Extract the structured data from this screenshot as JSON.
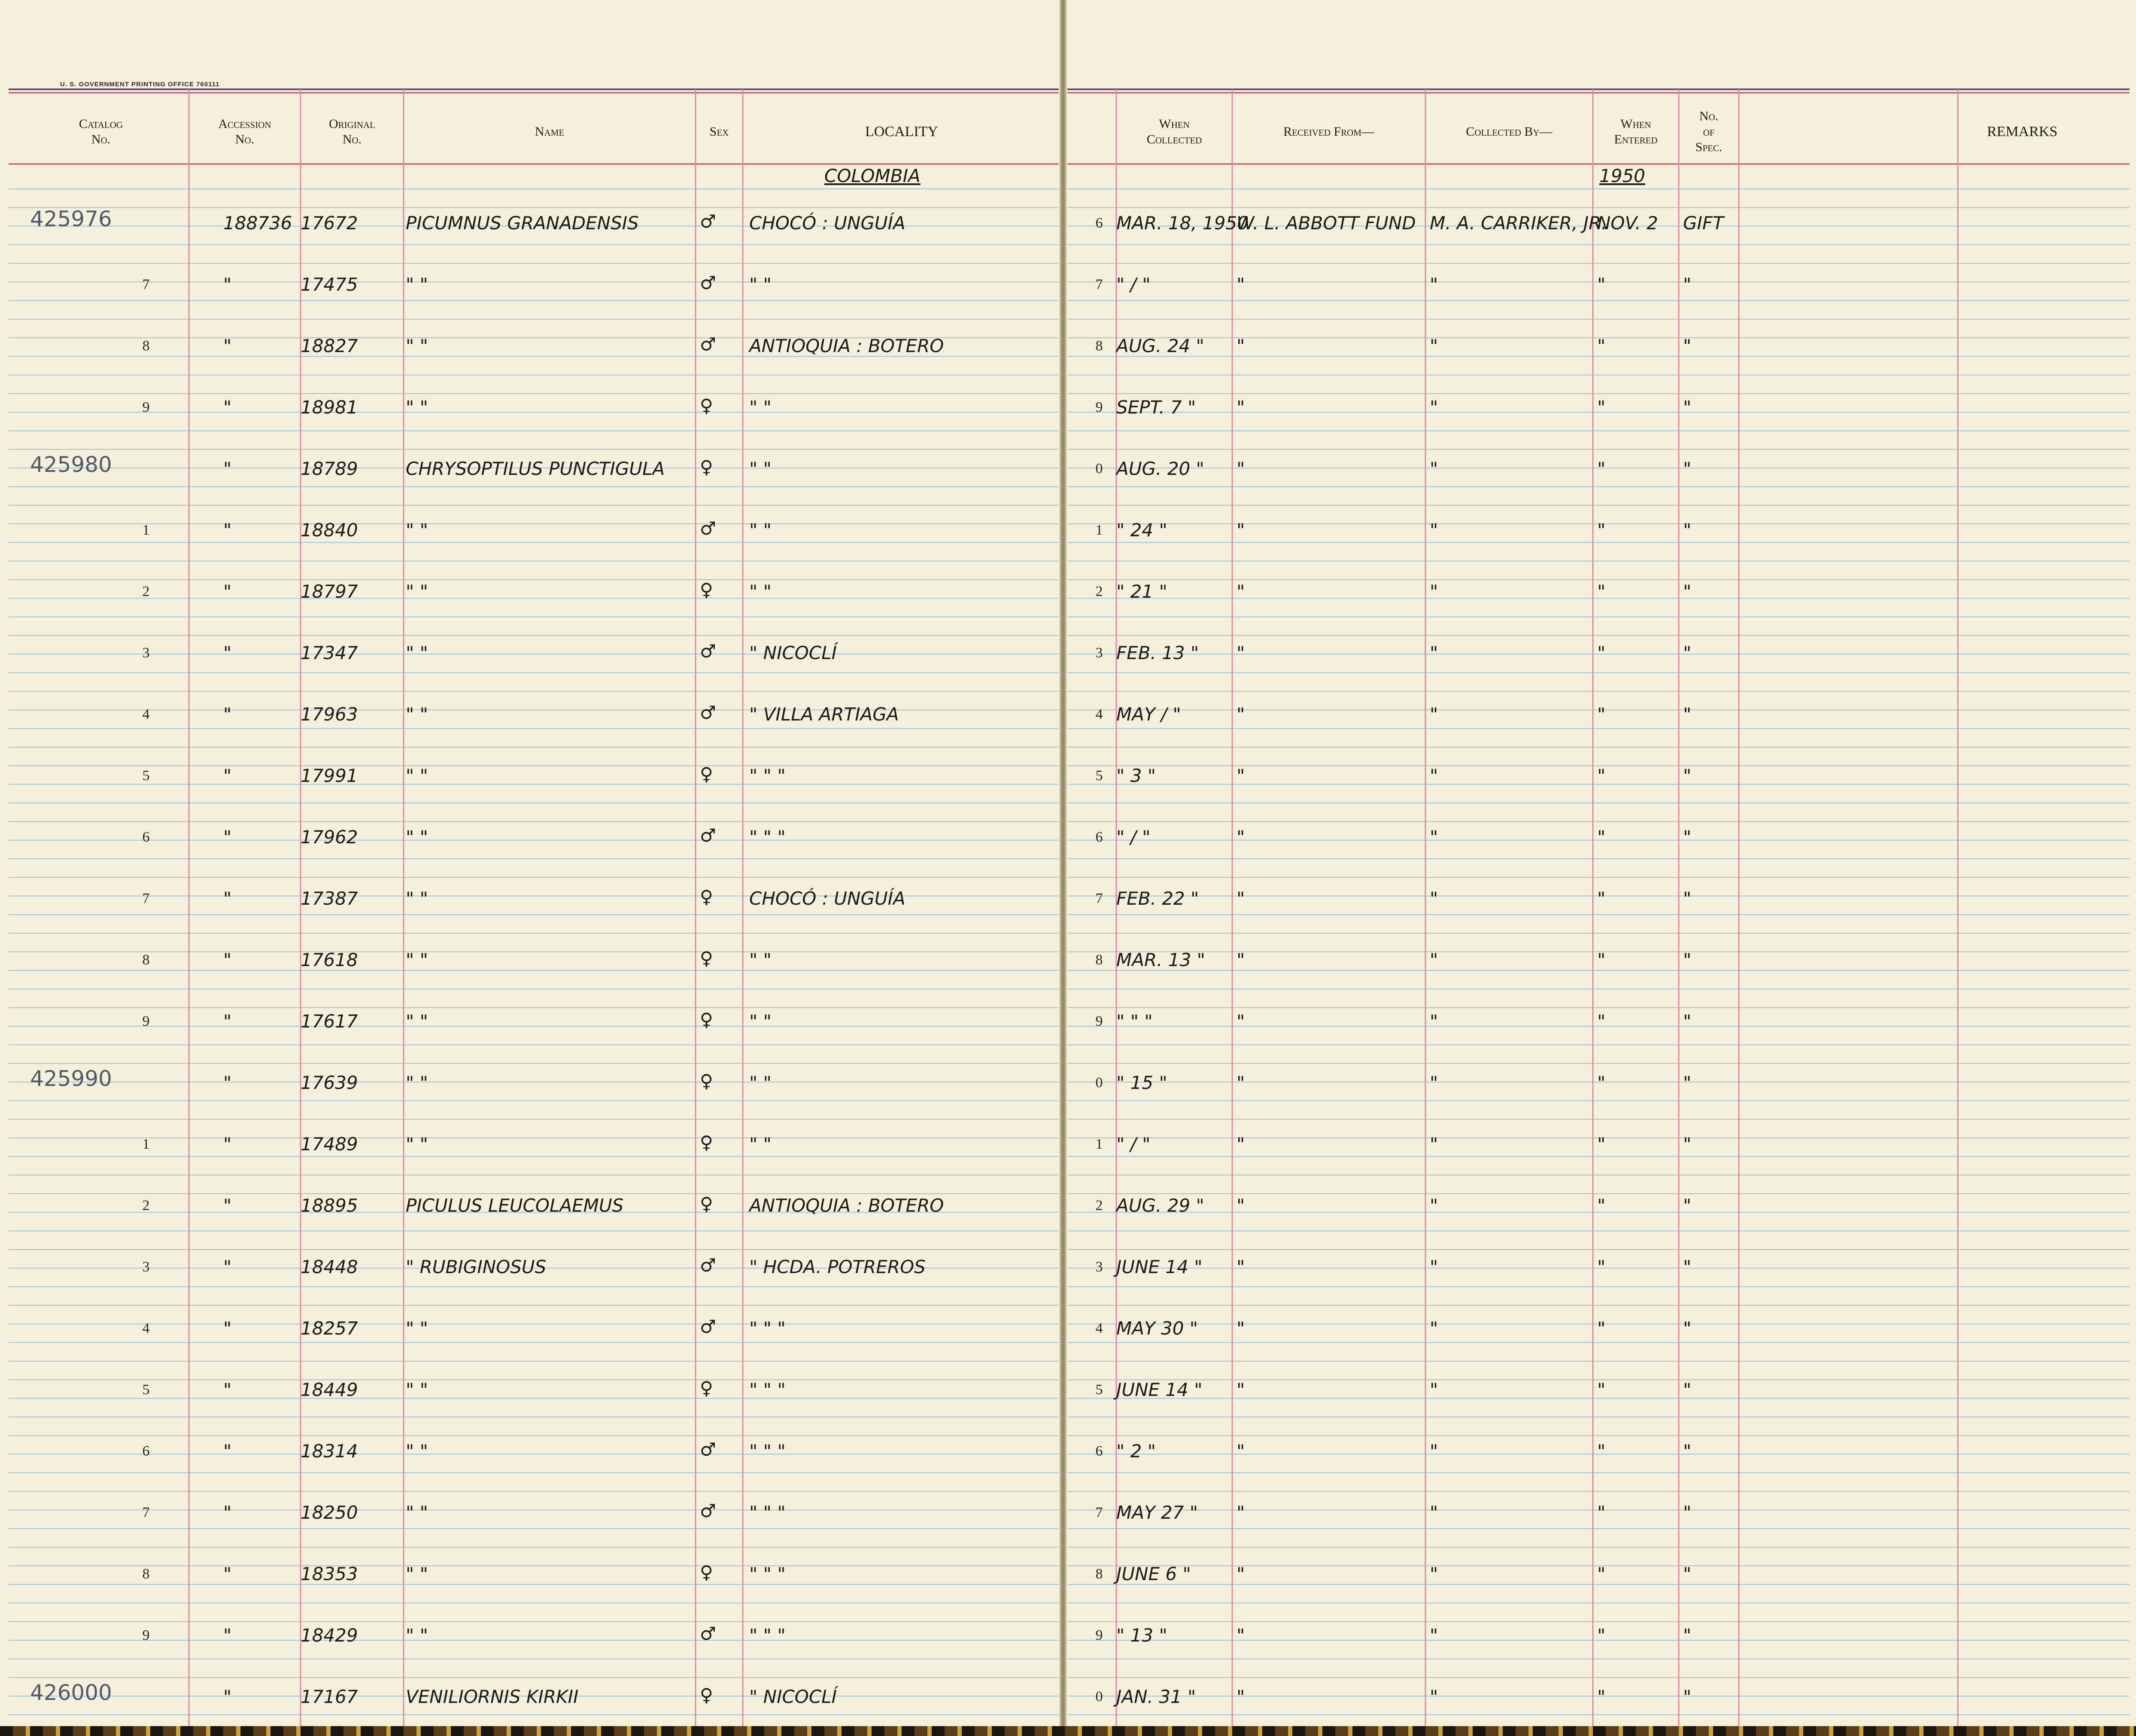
{
  "header": {
    "printer": "U. S. GOVERNMENT PRINTING OFFICE   760111",
    "columns": {
      "catalog": "Catalog\nNo.",
      "accession": "Accession\nNo.",
      "original": "Original\nNo.",
      "name": "Name",
      "sex": "Sex",
      "locality": "LOCALITY",
      "when_collected": "When\nCollected",
      "received_from": "Received From—",
      "collected_by": "Collected By—",
      "when_entered": "When\nEntered",
      "no_of_spec": "No.\nof\nSpec.",
      "remarks": "REMARKS"
    }
  },
  "section": {
    "locality_heading": "COLOMBIA",
    "year": "1950"
  },
  "rows": [
    {
      "catalog": "425976",
      "acc": "188736",
      "orig": "17672",
      "name": "PICUMNUS GRANADENSIS",
      "sex": "♂",
      "loc": "CHOCÓ : UNGUÍA",
      "num": "6",
      "when": "MAR. 18, 1950",
      "recv": "W. L. ABBOTT FUND",
      "coll": "M. A. CARRIKER, JR.",
      "entered": "NOV. 2",
      "spec": "GIFT"
    },
    {
      "catalog": "",
      "rn": "7",
      "acc": "\"",
      "orig": "17475",
      "name": "\"             \"",
      "sex": "♂",
      "loc": "\"       \"",
      "num": "7",
      "when": "\" / \"",
      "recv": "\"",
      "coll": "\"",
      "entered": "\"",
      "spec": "\""
    },
    {
      "catalog": "",
      "rn": "8",
      "acc": "\"",
      "orig": "18827",
      "name": "\"             \"",
      "sex": "♂",
      "loc": "ANTIOQUIA : BOTERO",
      "num": "8",
      "when": "AUG. 24 \"",
      "recv": "\"",
      "coll": "\"",
      "entered": "\"",
      "spec": "\""
    },
    {
      "catalog": "",
      "rn": "9",
      "acc": "\"",
      "orig": "18981",
      "name": "\"             \"",
      "sex": "♀",
      "loc": "\"       \"",
      "num": "9",
      "when": "SEPT. 7 \"",
      "recv": "\"",
      "coll": "\"",
      "entered": "\"",
      "spec": "\""
    },
    {
      "catalog": "425980",
      "acc": "\"",
      "orig": "18789",
      "name": "CHRYSOPTILUS PUNCTIGULA",
      "sex": "♀",
      "loc": "\"       \"",
      "num": "0",
      "when": "AUG. 20 \"",
      "recv": "\"",
      "coll": "\"",
      "entered": "\"",
      "spec": "\""
    },
    {
      "catalog": "",
      "rn": "1",
      "acc": "\"",
      "orig": "18840",
      "name": "\"             \"",
      "sex": "♂",
      "loc": "\"       \"",
      "num": "1",
      "when": "\" 24 \"",
      "recv": "\"",
      "coll": "\"",
      "entered": "\"",
      "spec": "\""
    },
    {
      "catalog": "",
      "rn": "2",
      "acc": "\"",
      "orig": "18797",
      "name": "\"             \"",
      "sex": "♀",
      "loc": "\"       \"",
      "num": "2",
      "when": "\" 21 \"",
      "recv": "\"",
      "coll": "\"",
      "entered": "\"",
      "spec": "\""
    },
    {
      "catalog": "",
      "rn": "3",
      "acc": "\"",
      "orig": "17347",
      "name": "\"             \"",
      "sex": "♂",
      "loc": "\"       NICOCLÍ",
      "num": "3",
      "when": "FEB. 13 \"",
      "recv": "\"",
      "coll": "\"",
      "entered": "\"",
      "spec": "\""
    },
    {
      "catalog": "",
      "rn": "4",
      "acc": "\"",
      "orig": "17963",
      "name": "\"             \"",
      "sex": "♂",
      "loc": "\"       VILLA ARTIAGA",
      "num": "4",
      "when": "MAY / \"",
      "recv": "\"",
      "coll": "\"",
      "entered": "\"",
      "spec": "\""
    },
    {
      "catalog": "",
      "rn": "5",
      "acc": "\"",
      "orig": "17991",
      "name": "\"             \"",
      "sex": "♀",
      "loc": "\"       \"     \"",
      "num": "5",
      "when": "\" 3 \"",
      "recv": "\"",
      "coll": "\"",
      "entered": "\"",
      "spec": "\""
    },
    {
      "catalog": "",
      "rn": "6",
      "acc": "\"",
      "orig": "17962",
      "name": "\"             \"",
      "sex": "♂",
      "loc": "\"       \"     \"",
      "num": "6",
      "when": "\" / \"",
      "recv": "\"",
      "coll": "\"",
      "entered": "\"",
      "spec": "\""
    },
    {
      "catalog": "",
      "rn": "7",
      "acc": "\"",
      "orig": "17387",
      "name": "\"             \"",
      "sex": "♀",
      "loc": "CHOCÓ : UNGUÍA",
      "num": "7",
      "when": "FEB. 22 \"",
      "recv": "\"",
      "coll": "\"",
      "entered": "\"",
      "spec": "\""
    },
    {
      "catalog": "",
      "rn": "8",
      "acc": "\"",
      "orig": "17618",
      "name": "\"             \"",
      "sex": "♀",
      "loc": "\"       \"",
      "num": "8",
      "when": "MAR. 13 \"",
      "recv": "\"",
      "coll": "\"",
      "entered": "\"",
      "spec": "\""
    },
    {
      "catalog": "",
      "rn": "9",
      "acc": "\"",
      "orig": "17617",
      "name": "\"             \"",
      "sex": "♀",
      "loc": "\"       \"",
      "num": "9",
      "when": "\" \" \"",
      "recv": "\"",
      "coll": "\"",
      "entered": "\"",
      "spec": "\""
    },
    {
      "catalog": "425990",
      "acc": "\"",
      "orig": "17639",
      "name": "\"             \"",
      "sex": "♀",
      "loc": "\"       \"",
      "num": "0",
      "when": "\" 15 \"",
      "recv": "\"",
      "coll": "\"",
      "entered": "\"",
      "spec": "\""
    },
    {
      "catalog": "",
      "rn": "1",
      "acc": "\"",
      "orig": "17489",
      "name": "\"             \"",
      "sex": "♀",
      "loc": "\"       \"",
      "num": "1",
      "when": "\" / \"",
      "recv": "\"",
      "coll": "\"",
      "entered": "\"",
      "spec": "\""
    },
    {
      "catalog": "",
      "rn": "2",
      "acc": "\"",
      "orig": "18895",
      "name": "PICULUS LEUCOLAEMUS",
      "sex": "♀",
      "loc": "ANTIOQUIA : BOTERO",
      "num": "2",
      "when": "AUG. 29 \"",
      "recv": "\"",
      "coll": "\"",
      "entered": "\"",
      "spec": "\""
    },
    {
      "catalog": "",
      "rn": "3",
      "acc": "\"",
      "orig": "18448",
      "name": "\"     RUBIGINOSUS",
      "sex": "♂",
      "loc": "\"       HCDA. POTREROS",
      "num": "3",
      "when": "JUNE 14 \"",
      "recv": "\"",
      "coll": "\"",
      "entered": "\"",
      "spec": "\""
    },
    {
      "catalog": "",
      "rn": "4",
      "acc": "\"",
      "orig": "18257",
      "name": "\"             \"",
      "sex": "♂",
      "loc": "\"       \"     \"",
      "num": "4",
      "when": "MAY 30 \"",
      "recv": "\"",
      "coll": "\"",
      "entered": "\"",
      "spec": "\""
    },
    {
      "catalog": "",
      "rn": "5",
      "acc": "\"",
      "orig": "18449",
      "name": "\"             \"",
      "sex": "♀",
      "loc": "\"       \"     \"",
      "num": "5",
      "when": "JUNE 14 \"",
      "recv": "\"",
      "coll": "\"",
      "entered": "\"",
      "spec": "\""
    },
    {
      "catalog": "",
      "rn": "6",
      "acc": "\"",
      "orig": "18314",
      "name": "\"             \"",
      "sex": "♂",
      "loc": "\"       \"     \"",
      "num": "6",
      "when": "\" 2 \"",
      "recv": "\"",
      "coll": "\"",
      "entered": "\"",
      "spec": "\""
    },
    {
      "catalog": "",
      "rn": "7",
      "acc": "\"",
      "orig": "18250",
      "name": "\"             \"",
      "sex": "♂",
      "loc": "\"       \"     \"",
      "num": "7",
      "when": "MAY 27 \"",
      "recv": "\"",
      "coll": "\"",
      "entered": "\"",
      "spec": "\""
    },
    {
      "catalog": "",
      "rn": "8",
      "acc": "\"",
      "orig": "18353",
      "name": "\"             \"",
      "sex": "♀",
      "loc": "\"       \"     \"",
      "num": "8",
      "when": "JUNE 6 \"",
      "recv": "\"",
      "coll": "\"",
      "entered": "\"",
      "spec": "\""
    },
    {
      "catalog": "",
      "rn": "9",
      "acc": "\"",
      "orig": "18429",
      "name": "\"             \"",
      "sex": "♂",
      "loc": "\"       \"     \"",
      "num": "9",
      "when": "\" 13 \"",
      "recv": "\"",
      "coll": "\"",
      "entered": "\"",
      "spec": "\""
    },
    {
      "catalog": "426000",
      "acc": "\"",
      "orig": "17167",
      "name": "VENILIORNIS KIRKII",
      "sex": "♀",
      "loc": "\"       NICOCLÍ",
      "num": "0",
      "when": "JAN. 31 \"",
      "recv": "\"",
      "coll": "\"",
      "entered": "\"",
      "spec": "\""
    }
  ]
}
